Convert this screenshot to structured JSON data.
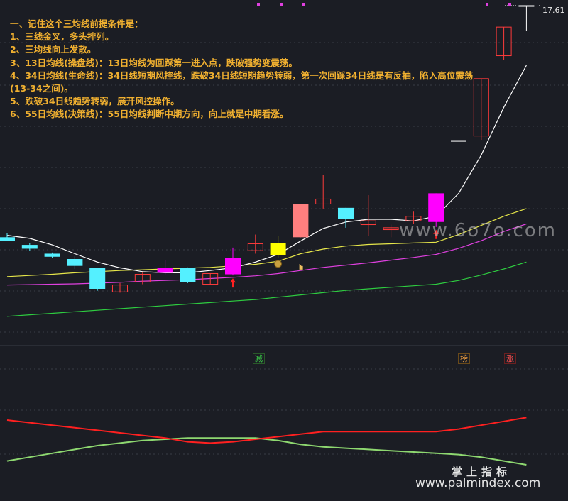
{
  "notes": [
    "一、记住这个三均线前提条件是：",
    "1、三线金叉，多头排列。",
    "2、三均线向上发散。",
    "3、13日均线(操盘线)：13日均线为回踩第一进入点，跌破强势变震荡。",
    "4、34日均线(生命线)：34日线短期风控线，跌破34日线短期趋势转弱，第一次回踩34日线是有反抽，陷入高位震荡",
    "(13-34之间)。",
    "5、跌破34日线趋势转弱，展开风控操作。",
    "6、55日均线(决策线)：55日均线判断中期方向，向上就是中期看涨。"
  ],
  "price_label": "17.61",
  "signals": {
    "reduce": "减",
    "list": "榜",
    "rise": "涨"
  },
  "watermarks": {
    "domain": "www.6o7o.com",
    "brand": "掌上指标",
    "site": "www.palmindex.com"
  },
  "colors": {
    "background": "#1b1d24",
    "notes": "#f0b030",
    "up_candle": "#ff3b3b",
    "down_candle": "#54f0ff",
    "magenta_candle": "#ff00ff",
    "yellow_candle": "#ffff00",
    "pink_candle": "#ff7f7f",
    "ma13": "#ffffff",
    "ma34": "#e6e64a",
    "ma55": "#e040e0",
    "ma_long": "#2ecc40",
    "ind_red": "#ff2020",
    "ind_green": "#8ed870"
  },
  "chart_data": {
    "type": "candlestick",
    "candles": [
      {
        "open": 11.55,
        "close": 11.45,
        "high": 11.65,
        "low": 11.45,
        "color": "cyan",
        "filled": true
      },
      {
        "open": 11.35,
        "close": 11.25,
        "high": 11.4,
        "low": 11.2,
        "color": "cyan",
        "filled": true
      },
      {
        "open": 11.12,
        "close": 11.04,
        "high": 11.15,
        "low": 11.0,
        "color": "cyan",
        "filled": true
      },
      {
        "open": 10.98,
        "close": 10.8,
        "high": 11.05,
        "low": 10.72,
        "color": "cyan",
        "filled": true
      },
      {
        "open": 10.75,
        "close": 10.2,
        "high": 10.75,
        "low": 10.15,
        "color": "cyan",
        "filled": true
      },
      {
        "open": 10.12,
        "close": 10.3,
        "high": 10.35,
        "low": 10.1,
        "color": "red",
        "filled": false
      },
      {
        "open": 10.38,
        "close": 10.58,
        "high": 10.64,
        "low": 10.32,
        "color": "red",
        "filled": false
      },
      {
        "open": 10.62,
        "close": 10.75,
        "high": 10.95,
        "low": 10.58,
        "color": "magenta",
        "filled": true
      },
      {
        "open": 10.75,
        "close": 10.38,
        "high": 10.76,
        "low": 10.35,
        "color": "cyan",
        "filled": true
      },
      {
        "open": 10.32,
        "close": 10.6,
        "high": 10.6,
        "low": 10.3,
        "color": "red",
        "filled": false
      },
      {
        "open": 10.58,
        "close": 11.0,
        "high": 11.28,
        "low": 10.55,
        "color": "magenta",
        "filled": true
      },
      {
        "open": 11.2,
        "close": 11.38,
        "high": 11.62,
        "low": 11.12,
        "color": "red",
        "filled": false
      },
      {
        "open": 11.08,
        "close": 11.4,
        "high": 11.58,
        "low": 11.02,
        "color": "yellow",
        "filled": true
      },
      {
        "open": 11.55,
        "close": 12.42,
        "high": 12.42,
        "low": 11.55,
        "color": "pink",
        "filled": true
      },
      {
        "open": 12.42,
        "close": 12.55,
        "high": 13.18,
        "low": 12.3,
        "color": "red",
        "filled": false
      },
      {
        "open": 12.32,
        "close": 12.02,
        "high": 12.32,
        "low": 11.8,
        "color": "cyan",
        "filled": true
      },
      {
        "open": 11.88,
        "close": 11.98,
        "high": 12.65,
        "low": 11.58,
        "color": "red",
        "filled": false
      },
      {
        "open": 11.75,
        "close": 11.8,
        "high": 11.88,
        "low": 11.55,
        "color": "red",
        "filled": false
      },
      {
        "open": 11.98,
        "close": 12.1,
        "high": 12.22,
        "low": 11.9,
        "color": "red",
        "filled": false
      },
      {
        "open": 12.7,
        "close": 11.95,
        "high": 12.7,
        "low": 11.82,
        "color": "magenta",
        "filled": true
      },
      {
        "open": 14.08,
        "close": 14.08,
        "high": 14.08,
        "low": 14.08,
        "color": "white",
        "filled": false
      },
      {
        "open": 14.2,
        "close": 15.7,
        "high": 15.7,
        "low": 14.1,
        "color": "red",
        "filled": false
      },
      {
        "open": 16.3,
        "close": 17.05,
        "high": 17.05,
        "low": 16.18,
        "color": "red",
        "filled": false
      },
      {
        "open": 17.61,
        "close": 17.61,
        "high": 17.61,
        "low": 16.95,
        "color": "white",
        "filled": false
      }
    ],
    "ma13": [
      11.6,
      11.52,
      11.35,
      11.12,
      10.9,
      10.75,
      10.65,
      10.62,
      10.62,
      10.68,
      10.75,
      10.9,
      11.1,
      11.45,
      11.78,
      11.95,
      12.02,
      12.02,
      11.98,
      12.1,
      12.7,
      13.7,
      14.95,
      16.05
    ],
    "ma34": [
      10.52,
      10.55,
      10.58,
      10.62,
      10.65,
      10.68,
      10.7,
      10.72,
      10.74,
      10.76,
      10.8,
      10.84,
      10.92,
      11.12,
      11.24,
      11.32,
      11.36,
      11.38,
      11.4,
      11.42,
      11.62,
      11.86,
      12.1,
      12.3
    ],
    "ma55": [
      10.3,
      10.31,
      10.32,
      10.33,
      10.35,
      10.37,
      10.4,
      10.42,
      10.44,
      10.47,
      10.5,
      10.54,
      10.6,
      10.68,
      10.76,
      10.82,
      10.88,
      10.95,
      11.02,
      11.1,
      11.26,
      11.46,
      11.7,
      11.9
    ],
    "ma_long": [
      9.48,
      9.52,
      9.56,
      9.6,
      9.64,
      9.68,
      9.72,
      9.76,
      9.8,
      9.84,
      9.88,
      9.92,
      9.98,
      10.04,
      10.1,
      10.16,
      10.2,
      10.24,
      10.28,
      10.32,
      10.42,
      10.56,
      10.72,
      10.9
    ],
    "buy_markers": [
      10,
      19
    ],
    "signal_candles": {
      "reduce": 11,
      "list": 20,
      "rise": 22
    },
    "indicator": {
      "red": [
        60,
        58,
        56,
        54,
        52,
        50,
        48,
        46,
        43,
        42,
        43,
        45,
        47,
        49,
        51,
        51,
        51,
        51,
        51,
        51,
        53,
        56,
        59,
        62
      ],
      "green": [
        28,
        31,
        34,
        37,
        40,
        42,
        44,
        45,
        46,
        46,
        46,
        46,
        44,
        41,
        39,
        38,
        37,
        36,
        35,
        34,
        33,
        31,
        28,
        25
      ]
    },
    "price_range": [
      8.9,
      17.61
    ],
    "indicator_range": [
      0,
      100
    ]
  }
}
